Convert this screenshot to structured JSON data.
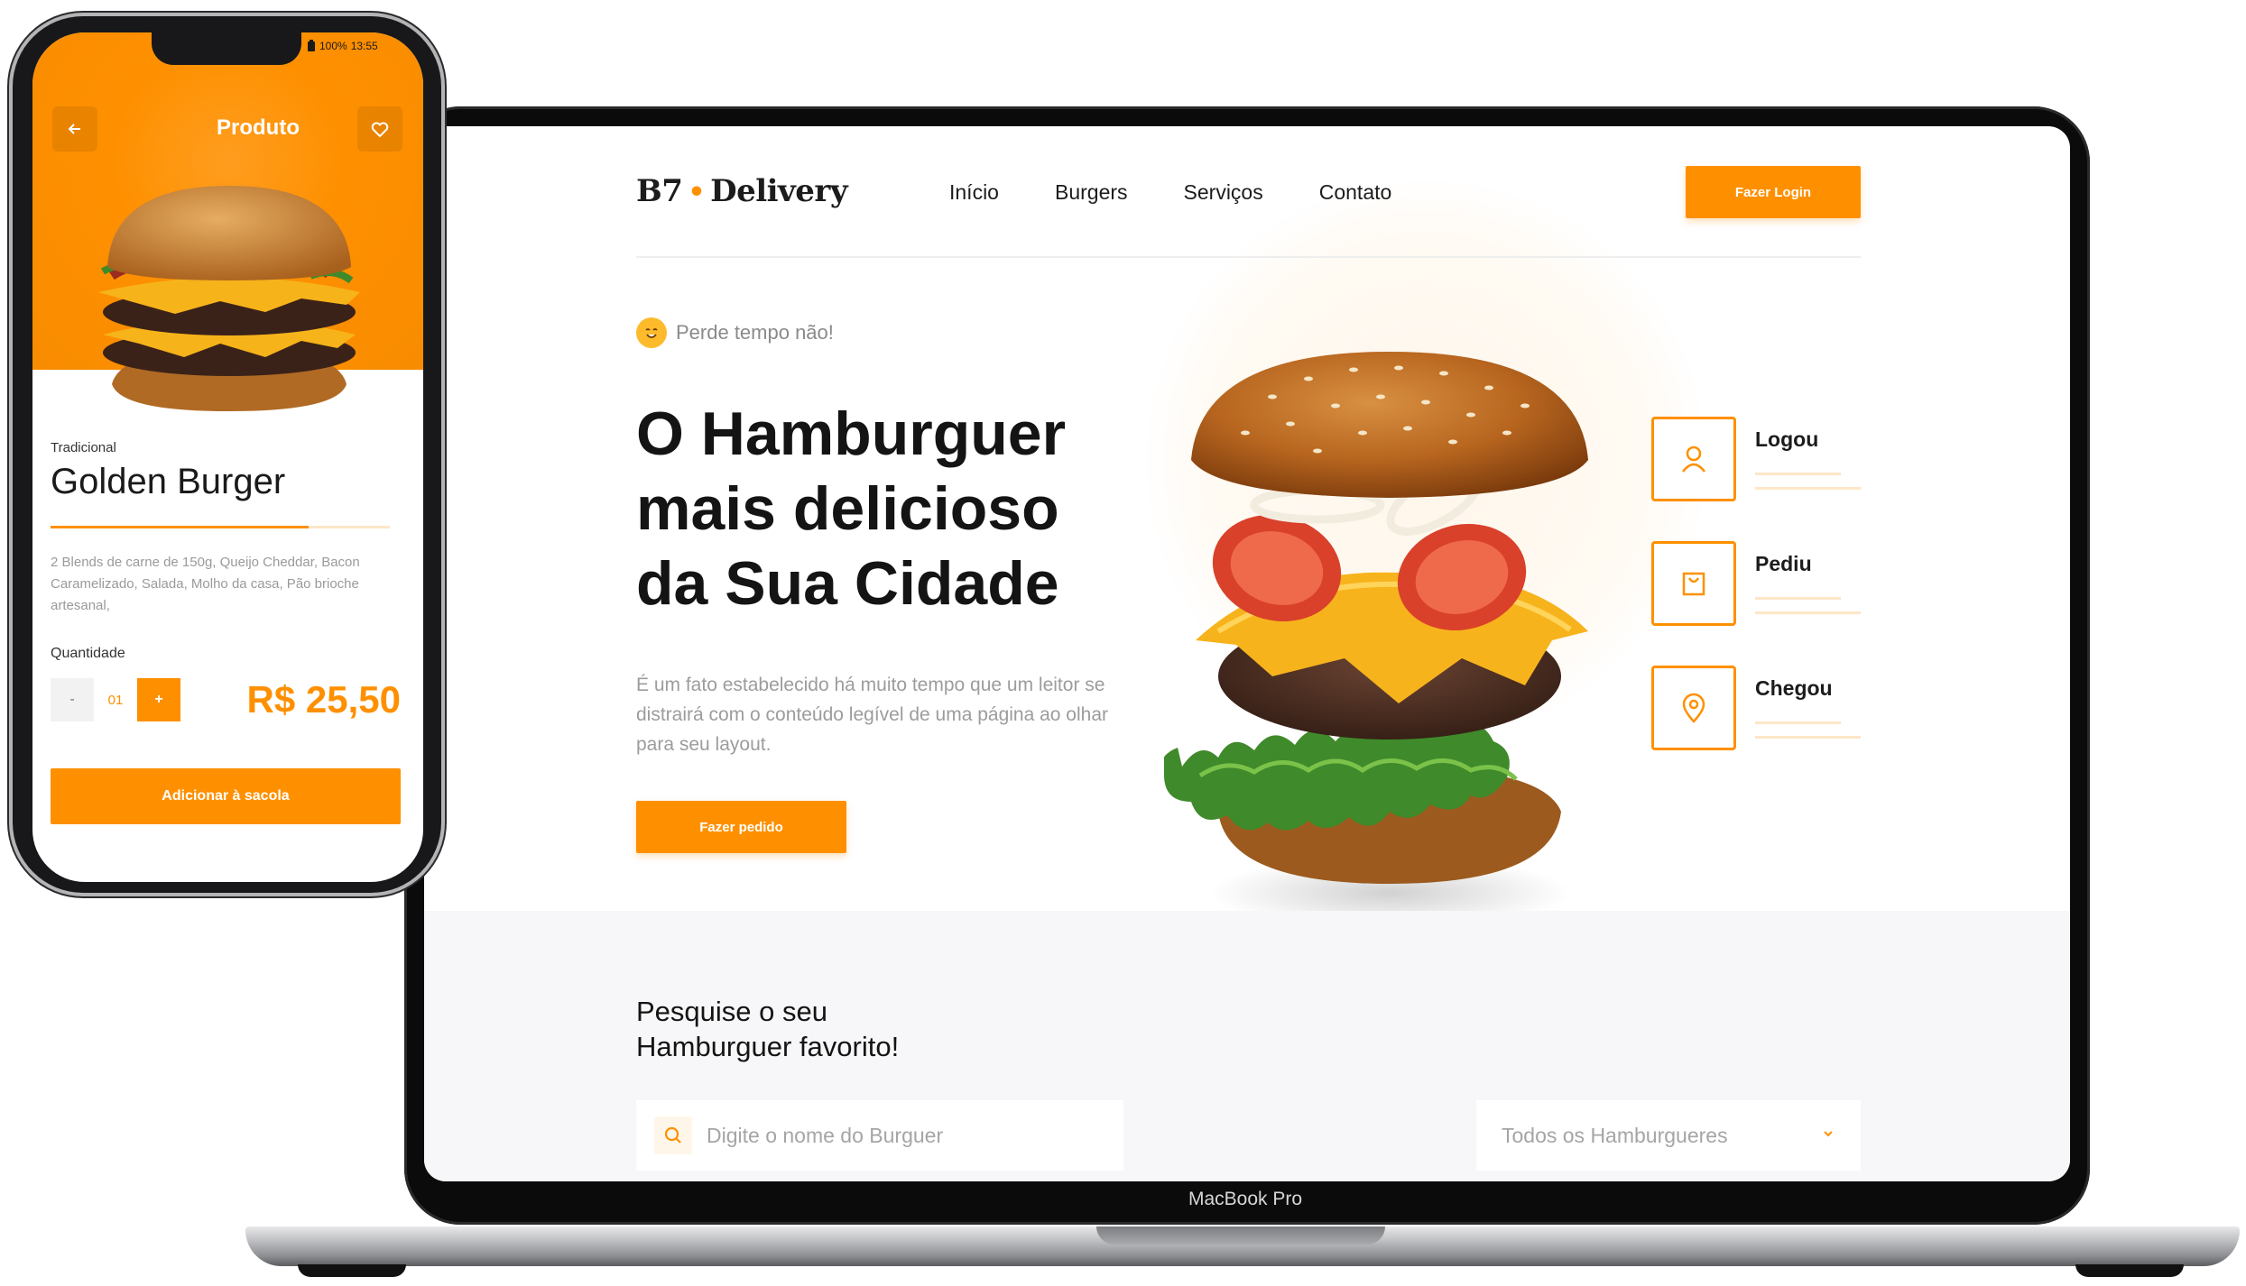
{
  "laptop": {
    "device_label": "MacBook Pro",
    "brand": {
      "part1": "B7",
      "part2": "Delivery"
    },
    "nav": [
      {
        "label": "Início"
      },
      {
        "label": "Burgers"
      },
      {
        "label": "Serviços"
      },
      {
        "label": "Contato"
      }
    ],
    "login_button": "Fazer Login",
    "hero": {
      "tagline": "Perde tempo não!",
      "title": "O Hamburguer mais delicioso da Sua Cidade",
      "description": "É um fato estabelecido há muito tempo que um leitor se distrairá com o conteúdo legível de uma página ao olhar para seu layout.",
      "order_button": "Fazer pedido"
    },
    "steps": [
      {
        "label": "Logou",
        "icon": "user-icon"
      },
      {
        "label": "Pediu",
        "icon": "bag-icon"
      },
      {
        "label": "Chegou",
        "icon": "location-pin-icon"
      }
    ],
    "search": {
      "title_line1": "Pesquise o seu",
      "title_line2": "Hamburguer favorito!",
      "placeholder": "Digite o nome do Burguer",
      "filter_selected": "Todos os Hamburgueres"
    }
  },
  "phone": {
    "status": {
      "battery": "100%",
      "time": "13:55"
    },
    "title": "Produto",
    "product": {
      "category": "Tradicional",
      "name": "Golden Burger",
      "description": "2 Blends de carne de 150g, Queijo Cheddar, Bacon Caramelizado, Salada, Molho da casa, Pão brioche artesanal,",
      "quantity_label": "Quantidade",
      "quantity_minus": "-",
      "quantity_value": "01",
      "quantity_plus": "+",
      "price": "R$ 25,50",
      "add_button": "Adicionar à sacola"
    }
  },
  "colors": {
    "accent": "#FE9000",
    "accent_light": "#FDE7C8",
    "text_dark": "#141414",
    "text_muted": "#9C9C9C",
    "section_bg": "#F7F7F9"
  }
}
